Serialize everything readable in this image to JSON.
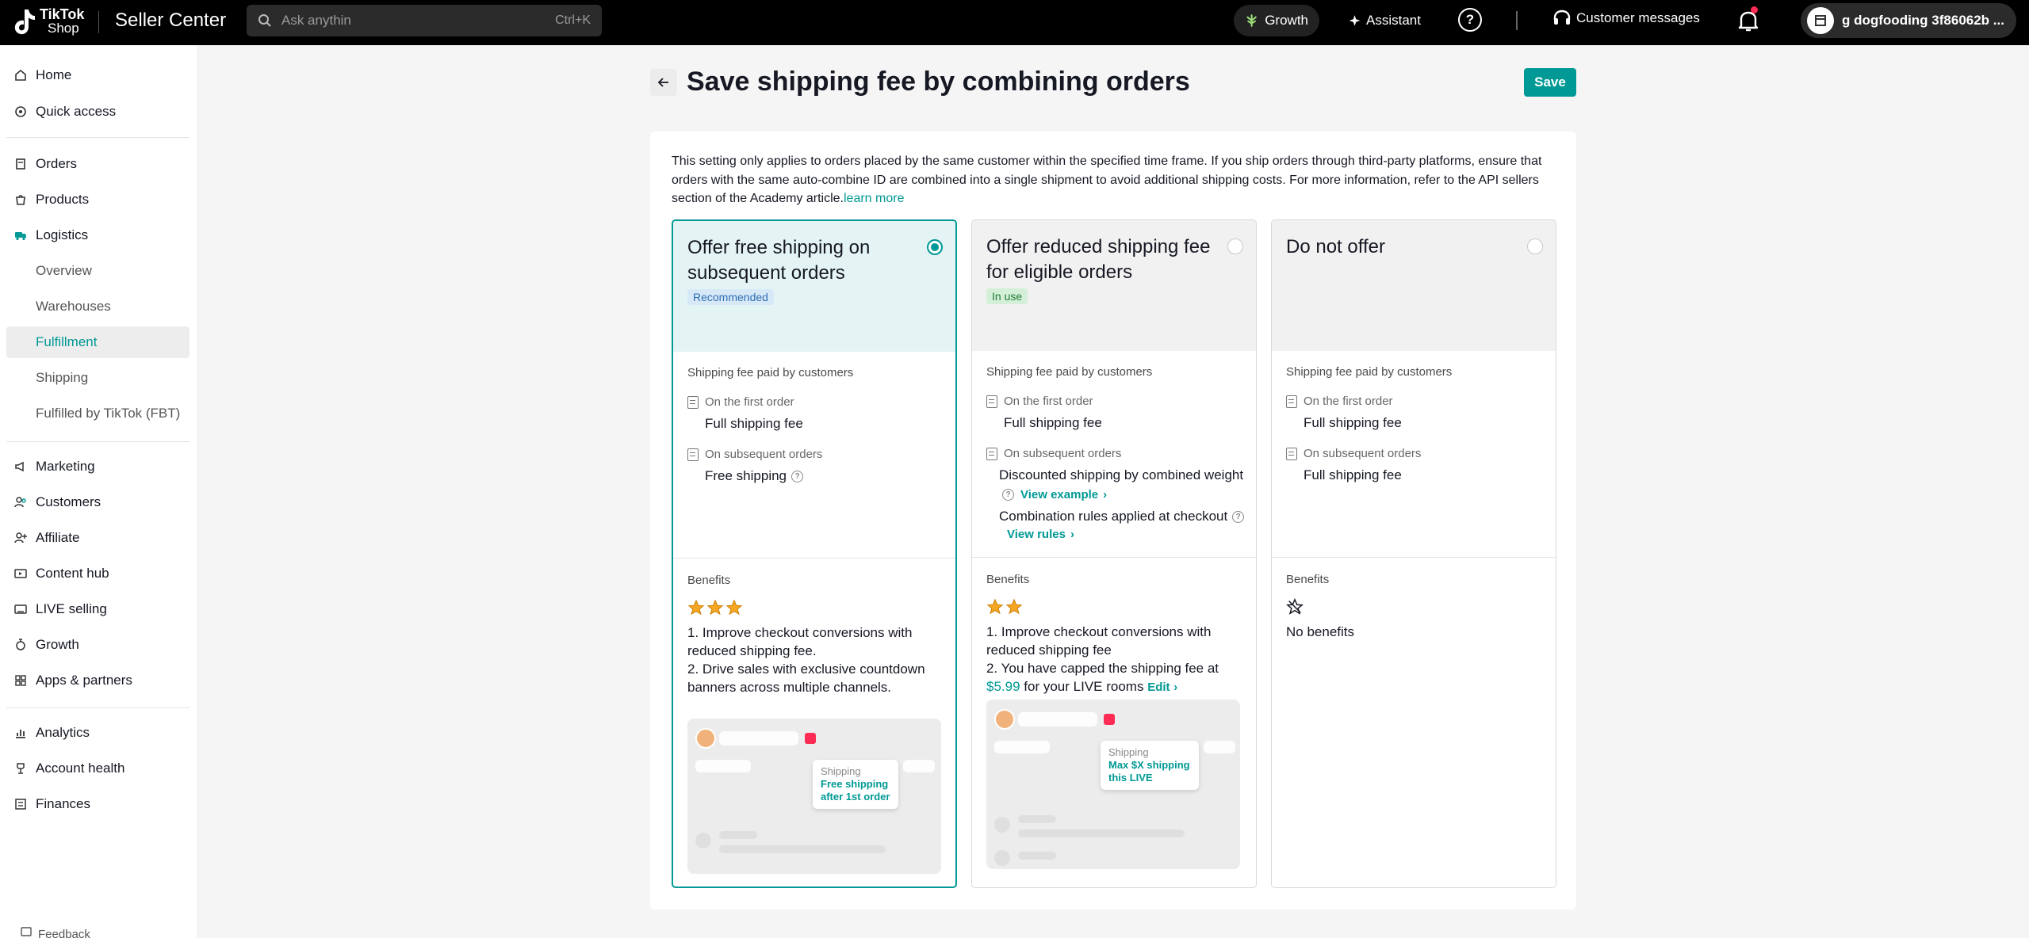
{
  "header": {
    "logo_brand": "TikTok",
    "logo_sub": "Shop",
    "app_title": "Seller Center",
    "search_placeholder": "Ask anythin",
    "search_shortcut": "Ctrl+K",
    "growth_label": "Growth",
    "assistant_label": "Assistant",
    "customer_messages_label": "Customer messages",
    "account_name": "g dogfooding 3f86062b ..."
  },
  "sidebar": {
    "items": [
      {
        "label": "Home",
        "icon": "home-icon"
      },
      {
        "label": "Quick access",
        "icon": "quick-access-icon"
      },
      {
        "label": "Orders",
        "icon": "orders-icon"
      },
      {
        "label": "Products",
        "icon": "products-icon"
      },
      {
        "label": "Logistics",
        "icon": "logistics-icon"
      },
      {
        "label": "Overview"
      },
      {
        "label": "Warehouses"
      },
      {
        "label": "Fulfillment"
      },
      {
        "label": "Shipping"
      },
      {
        "label": "Fulfilled by TikTok (FBT)"
      },
      {
        "label": "Marketing",
        "icon": "marketing-icon"
      },
      {
        "label": "Customers",
        "icon": "customers-icon"
      },
      {
        "label": "Affiliate",
        "icon": "affiliate-icon"
      },
      {
        "label": "Content hub",
        "icon": "content-hub-icon"
      },
      {
        "label": "LIVE selling",
        "icon": "live-icon"
      },
      {
        "label": "Growth",
        "icon": "growth-icon"
      },
      {
        "label": "Apps & partners",
        "icon": "apps-icon"
      },
      {
        "label": "Analytics",
        "icon": "analytics-icon"
      },
      {
        "label": "Account health",
        "icon": "trophy-icon"
      },
      {
        "label": "Finances",
        "icon": "finances-icon"
      }
    ],
    "feedback_label": "Feedback"
  },
  "page": {
    "title": "Save shipping fee by combining orders",
    "save_label": "Save",
    "description": "This setting only applies to orders placed by the same customer within the specified time frame. If you ship orders through third-party platforms, ensure that orders with the same auto-combine ID are combined into a single shipment to avoid additional shipping costs. For more information, refer to the API sellers section of the Academy article.",
    "learn_more": "learn more"
  },
  "options": [
    {
      "title": "Offer free shipping on subsequent orders",
      "badge": "Recommended",
      "selected": true,
      "section_label": "Shipping fee paid by customers",
      "first_order_label": "On the first order",
      "first_order_value": "Full shipping fee",
      "subsequent_label": "On subsequent orders",
      "subsequent_value": "Free shipping",
      "benefits_label": "Benefits",
      "stars": 3,
      "benefit_1": "1. Improve checkout conversions with reduced shipping fee.",
      "benefit_2": "2. Drive sales with exclusive countdown banners across multiple channels.",
      "tip_title": "Shipping",
      "tip_value": "Free shipping after 1st order"
    },
    {
      "title": "Offer reduced shipping fee for eligible orders",
      "badge": "In use",
      "selected": false,
      "section_label": "Shipping fee paid by customers",
      "first_order_label": "On the first order",
      "first_order_value": "Full shipping fee",
      "subsequent_label": "On subsequent orders",
      "subsequent_value": "Discounted shipping by combined weight",
      "view_example": "View example",
      "subsequent_value_2": "Combination rules applied at checkout",
      "view_rules": "View rules",
      "benefits_label": "Benefits",
      "stars": 2,
      "benefit_1": "1. Improve checkout conversions with reduced shipping fee",
      "benefit_2_pre": "2. You have capped the shipping fee at",
      "benefit_2_price": "$5.99",
      "benefit_2_post": "for your LIVE rooms",
      "edit_label": "Edit",
      "tip_title": "Shipping",
      "tip_value": "Max $X shipping this LIVE"
    },
    {
      "title": "Do not offer",
      "selected": false,
      "section_label": "Shipping fee paid by customers",
      "first_order_label": "On the first order",
      "first_order_value": "Full shipping fee",
      "subsequent_label": "On subsequent orders",
      "subsequent_value": "Full shipping fee",
      "benefits_label": "Benefits",
      "stars": 0,
      "no_benefits": "No benefits"
    }
  ],
  "colors": {
    "accent": "#009995",
    "selected_card_bg": "#e4f4f4",
    "star": "#f5a623"
  }
}
